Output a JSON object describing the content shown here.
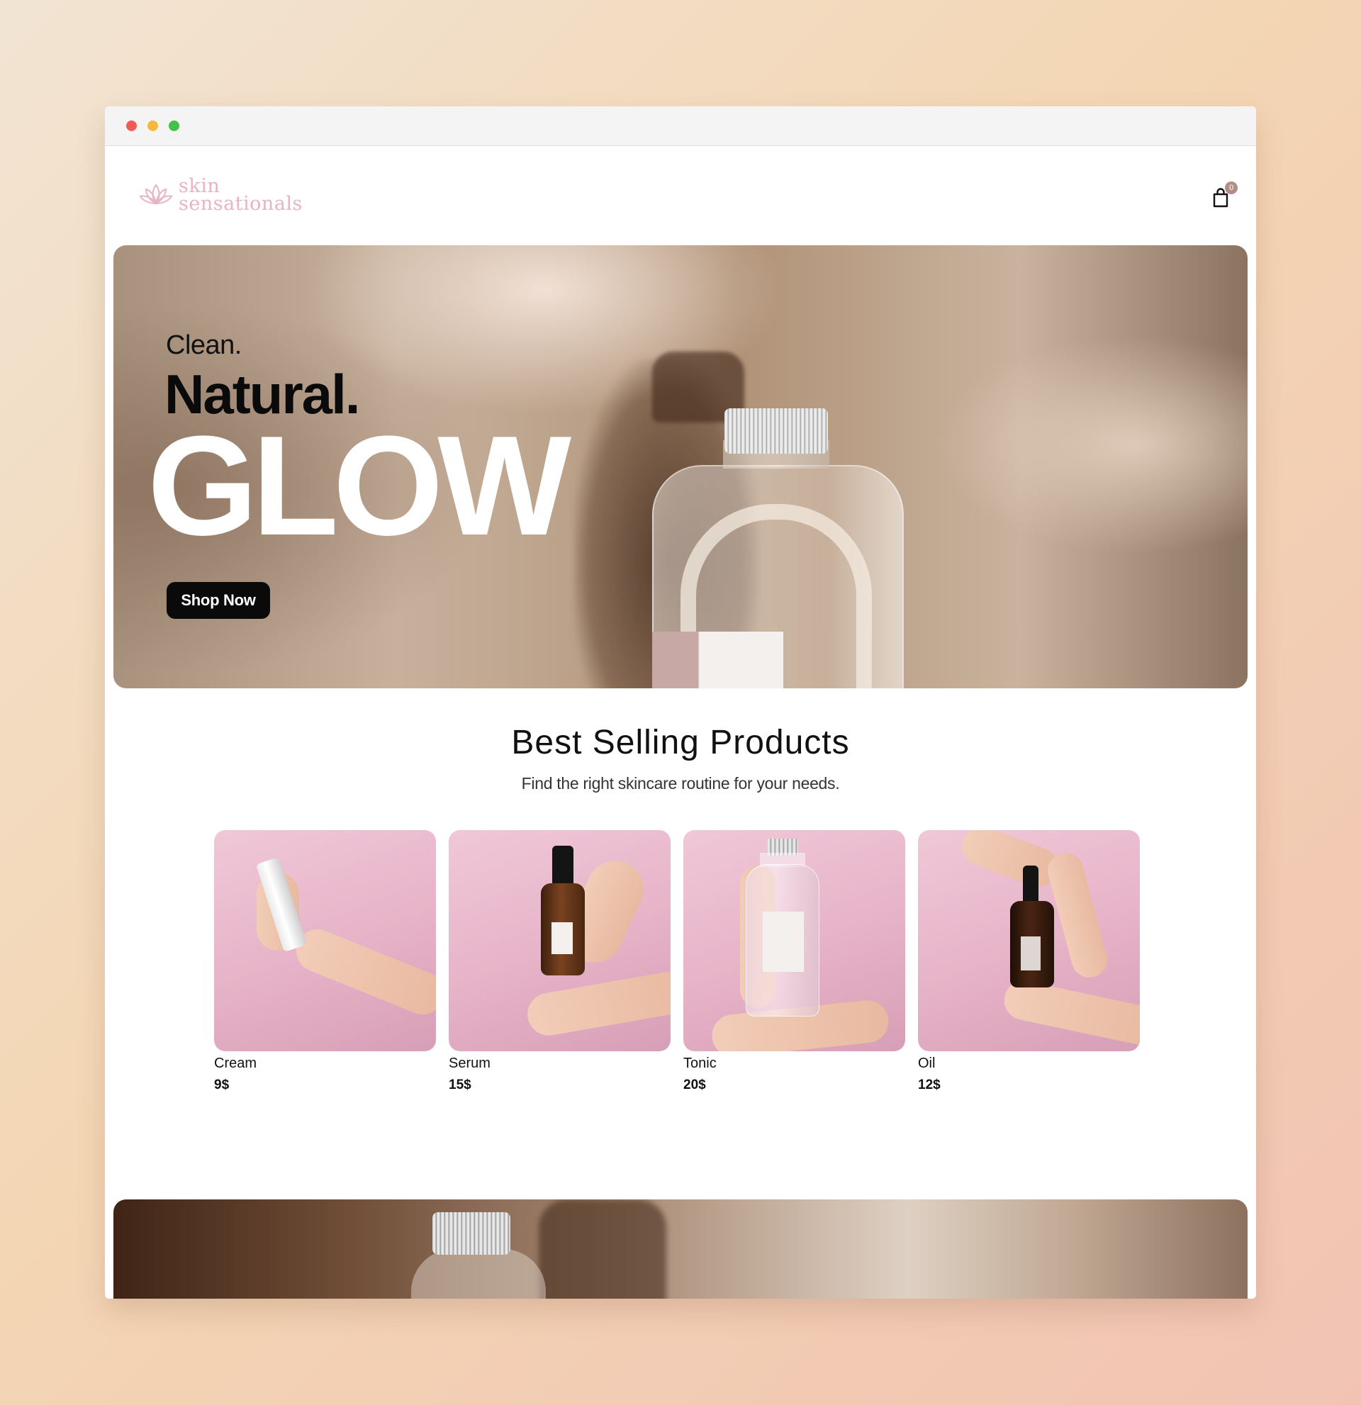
{
  "brand": {
    "line1": "skin",
    "line2": "sensationals",
    "color": "#e7b3c5",
    "icon": "lotus-icon"
  },
  "cart": {
    "icon": "shopping-bag-icon",
    "count": "0"
  },
  "hero": {
    "line1": "Clean.",
    "line2": "Natural.",
    "line3": "GLOW",
    "cta": "Shop Now"
  },
  "section": {
    "title": "Best Selling Products",
    "subtitle": "Find the right skincare routine for your needs."
  },
  "products": [
    {
      "name": "Cream",
      "price": "9$"
    },
    {
      "name": "Serum",
      "price": "15$"
    },
    {
      "name": "Tonic",
      "price": "20$"
    },
    {
      "name": "Oil",
      "price": "12$"
    }
  ],
  "colors": {
    "window_dots": [
      "#ee5c55",
      "#f5b83a",
      "#45c04a"
    ],
    "product_bg": "#e6b2c7",
    "button_bg": "#0a0a0a"
  }
}
